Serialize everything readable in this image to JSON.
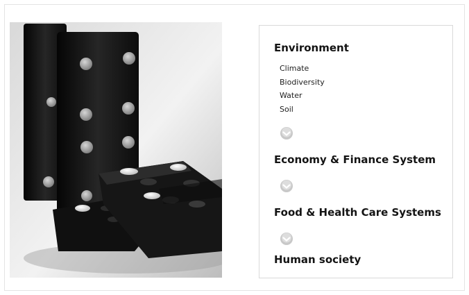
{
  "categories": [
    {
      "title": "Environment",
      "items": [
        "Climate",
        "Biodiversity",
        "Water",
        "Soil"
      ]
    },
    {
      "title": "Economy & Finance System",
      "items": []
    },
    {
      "title": "Food & Health Care Systems",
      "items": []
    },
    {
      "title": "Human society",
      "items": []
    }
  ],
  "icons": {
    "expand": "chevron-down-icon",
    "photo": "dominoes-photo"
  },
  "colors": {
    "heading": "#141414",
    "chevron_fill": "#c8c8c8",
    "panel_border": "#d9d9d9"
  }
}
